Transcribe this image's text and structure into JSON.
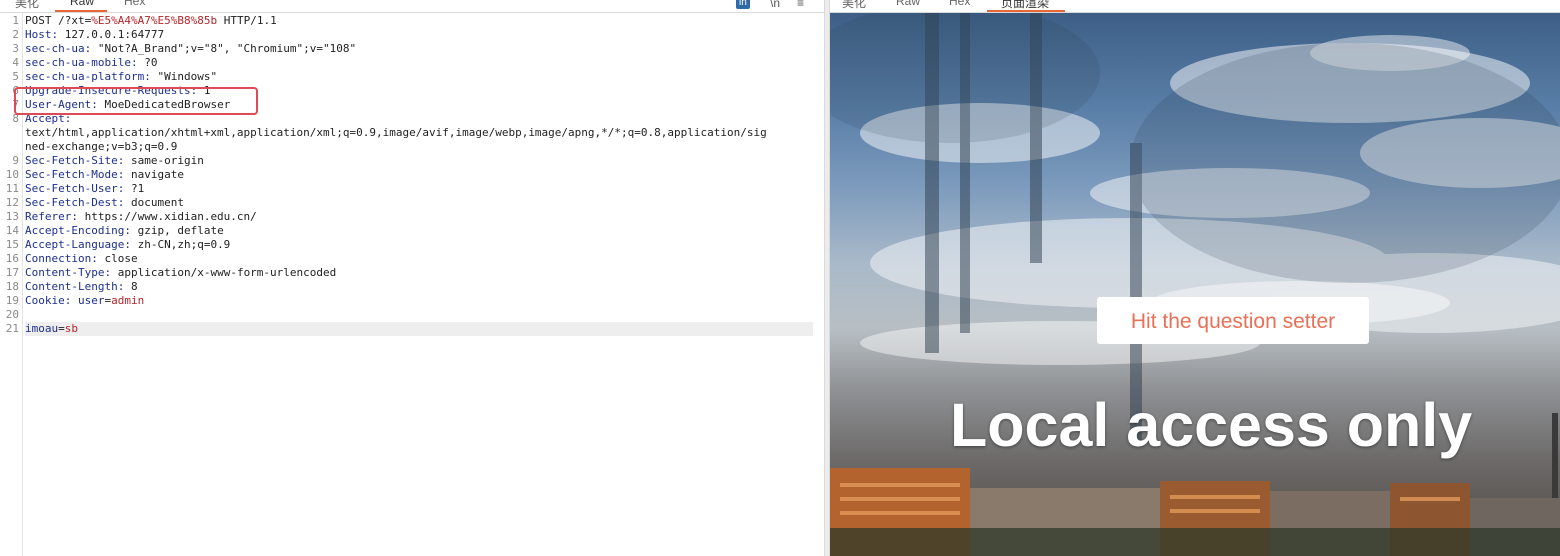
{
  "left_panel": {
    "tabs": [
      {
        "label": "美化",
        "active": false
      },
      {
        "label": "Raw",
        "active": true
      },
      {
        "label": "Hex",
        "active": false
      }
    ],
    "toolbar": {
      "line_wrap_label": "ln",
      "newline_label": "\\n",
      "menu_label": "≡"
    },
    "request": {
      "method": "POST",
      "path": "/?xt=",
      "path_param": "%E5%A4%A7%E5%B8%85b",
      "protocol": "HTTP/1.1",
      "headers": [
        {
          "num": "2",
          "name": "Host",
          "value": "127.0.0.1:64777"
        },
        {
          "num": "3",
          "name": "sec-ch-ua",
          "value": "\"Not?A_Brand\";v=\"8\", \"Chromium\";v=\"108\""
        },
        {
          "num": "4",
          "name": "sec-ch-ua-mobile",
          "value": "?0"
        },
        {
          "num": "5",
          "name": "sec-ch-ua-platform",
          "value": "\"Windows\""
        },
        {
          "num": "6",
          "name": "Upgrade-Insecure-Requests",
          "value": "1"
        },
        {
          "num": "7",
          "name": "User-Agent",
          "value": "MoeDedicatedBrowser"
        },
        {
          "num": "8",
          "name": "Accept",
          "value": ""
        }
      ],
      "accept_cont_1": "text/html,application/xhtml+xml,application/xml;q=0.9,image/avif,image/webp,image/apng,*/*;q=0.8,application/sig",
      "accept_cont_2": "ned-exchange;v=b3;q=0.9",
      "headers2": [
        {
          "num": "9",
          "name": "Sec-Fetch-Site",
          "value": "same-origin"
        },
        {
          "num": "10",
          "name": "Sec-Fetch-Mode",
          "value": "navigate"
        },
        {
          "num": "11",
          "name": "Sec-Fetch-User",
          "value": "?1"
        },
        {
          "num": "12",
          "name": "Sec-Fetch-Dest",
          "value": "document"
        },
        {
          "num": "13",
          "name": "Referer",
          "value": "https://www.xidian.edu.cn/"
        },
        {
          "num": "14",
          "name": "Accept-Encoding",
          "value": "gzip, deflate"
        },
        {
          "num": "15",
          "name": "Accept-Language",
          "value": "zh-CN,zh;q=0.9"
        },
        {
          "num": "16",
          "name": "Connection",
          "value": "close"
        },
        {
          "num": "17",
          "name": "Content-Type",
          "value": "application/x-www-form-urlencoded"
        },
        {
          "num": "18",
          "name": "Content-Length",
          "value": "8"
        }
      ],
      "cookie_name": "Cookie",
      "cookie_key": "user",
      "cookie_value": "admin",
      "body_key": "imoau",
      "body_value": "sb"
    }
  },
  "right_panel": {
    "tabs": [
      {
        "label": "美化",
        "active": false
      },
      {
        "label": "Raw",
        "active": false
      },
      {
        "label": "Hex",
        "active": false
      },
      {
        "label": "页面渲染",
        "active": true
      }
    ],
    "button_label": "Hit the question setter",
    "headline": "Local access only"
  },
  "colors": {
    "accent": "#e8673a",
    "header_name": "#1d2f8f",
    "param_value": "#b4252a",
    "highlight_box": "#e04a57",
    "button_text": "#e97056"
  }
}
